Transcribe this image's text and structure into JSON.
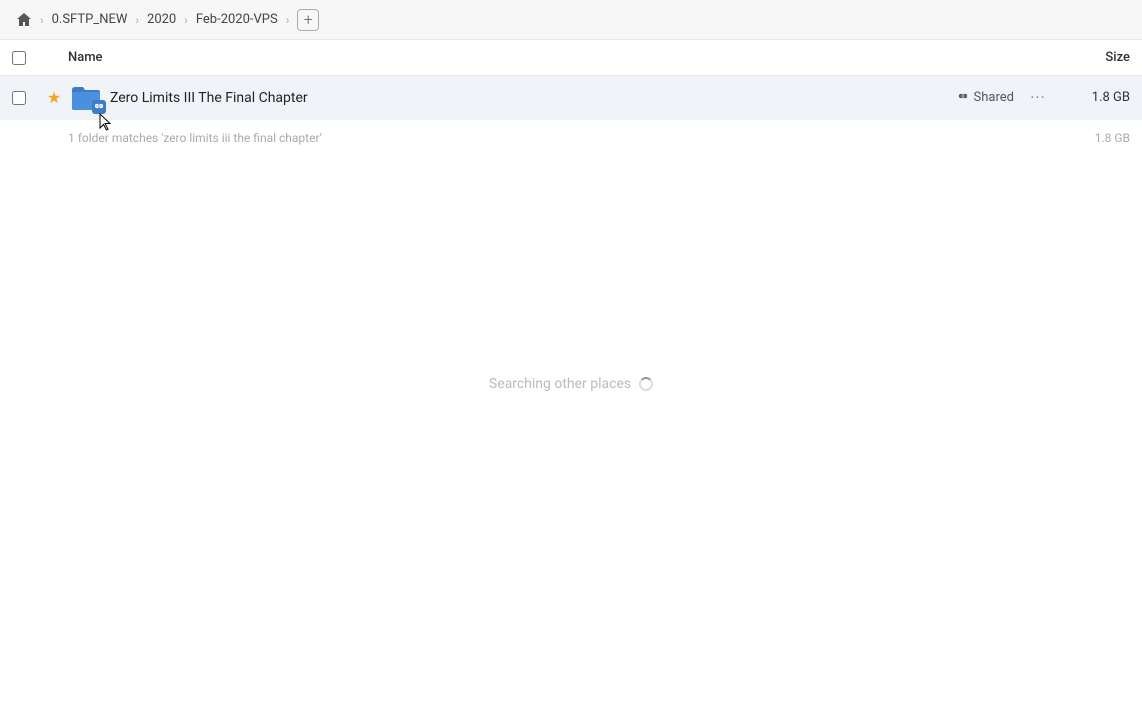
{
  "breadcrumb": {
    "home_label": "Home",
    "items": [
      {
        "label": "0.SFTP_NEW"
      },
      {
        "label": "2020"
      },
      {
        "label": "Feb-2020-VPS"
      }
    ],
    "add_button_label": "+"
  },
  "columns": {
    "name_label": "Name",
    "size_label": "Size"
  },
  "file_row": {
    "name": "Zero Limits III The Final Chapter",
    "shared_label": "Shared",
    "size": "1.8 GB"
  },
  "summary": {
    "text": "1 folder matches 'zero limits iii the final chapter'",
    "size": "1.8 GB"
  },
  "searching": {
    "text": "Searching other places"
  }
}
